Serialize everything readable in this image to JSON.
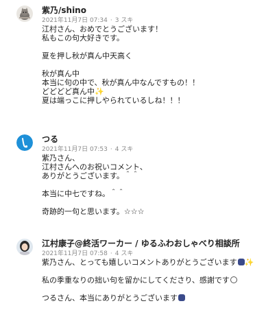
{
  "comments": [
    {
      "author": "紫乃/shino",
      "date": "2021年11月7日 07:34",
      "likes": "3 スキ",
      "avatar_icon": "cat-avatar-icon",
      "lines": [
        "江村さん、おめでとうございます！",
        "私もこの句大好きです。",
        "",
        "夏を押し秋が真ん中天高く",
        "",
        "秋が真ん中",
        "本当に句の中で、秋が真ん中なんですもの！！",
        "どどどど真ん中",
        "夏は端っこに押しやられているしね！！！"
      ]
    },
    {
      "author": "つる",
      "date": "2021年11月7日 07:53",
      "likes": "4 スキ",
      "avatar_icon": "crane-avatar-icon",
      "avatar_color": "#1e90d8",
      "lines": [
        "紫乃さん、",
        "江村さんへのお祝いコメント、",
        "ありがとうございます。＾＾",
        "",
        "本当に中七ですね。＾＾",
        "",
        "奇跡的一句と思います。☆☆☆"
      ]
    },
    {
      "author": "江村康子@終活ワーカー / ゆるふわおしゃべり相談所",
      "date": "2021年11月7日 07:58",
      "likes": "4 スキ",
      "avatar_icon": "woman-avatar-icon",
      "lines": [
        "紫乃さん、とっても嬉しいコメントありがとうございます",
        "",
        "私の季重なりの拙い句を留かにしてくださり、感謝です",
        "",
        "つるさん、本当にありがとうございます"
      ]
    }
  ],
  "meta_separator": "·"
}
